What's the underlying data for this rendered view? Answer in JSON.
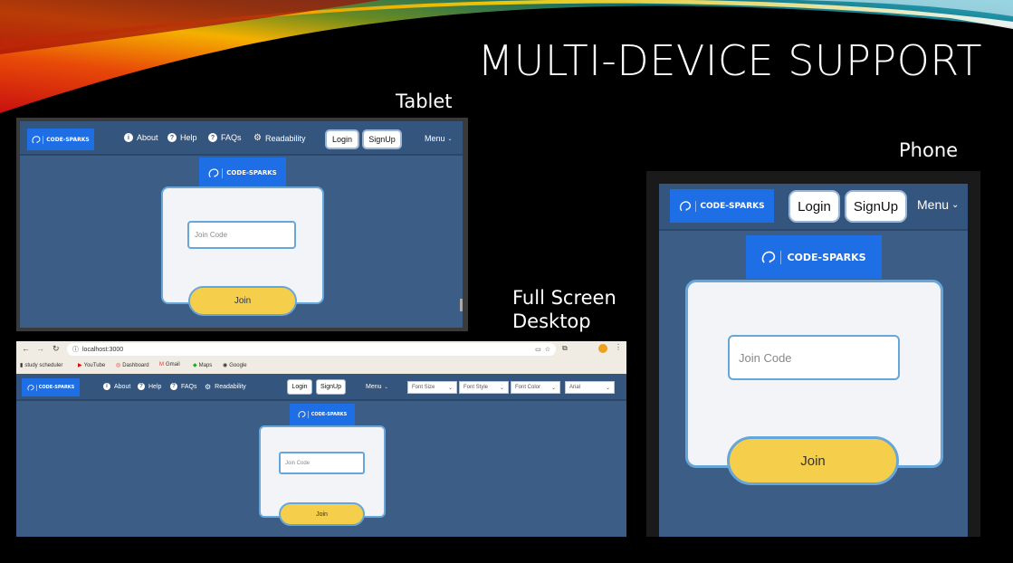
{
  "slide": {
    "title": "MULTI-DEVICE SUPPORT",
    "labels": {
      "tablet": "Tablet",
      "phone": "Phone",
      "desktop_line1": "Full Screen",
      "desktop_line2": "Desktop"
    }
  },
  "app": {
    "brand": "CODE-SPARKS",
    "nav": {
      "about": "About",
      "help": "Help",
      "faqs": "FAQs",
      "readability": "Readability"
    },
    "login_label": "Login",
    "signup_label": "SignUp",
    "menu_label": "Menu",
    "join_placeholder": "Join Code",
    "join_label": "Join"
  },
  "browser": {
    "url": "localhost:3000",
    "bookmarks": [
      "study scheduler",
      "YouTube",
      "Dashboard",
      "Gmail",
      "Maps",
      "Google"
    ]
  },
  "readability_controls": {
    "font_size": "Font Size",
    "font_style": "Font Style",
    "font_color": "Font Color",
    "font_family": "Arial"
  },
  "colors": {
    "nav_bg": "#34557e",
    "page_bg": "#3c5d85",
    "brand_bg": "#1e6ee6",
    "join_button": "#f5cf4b",
    "card_border": "#66a6d8"
  }
}
